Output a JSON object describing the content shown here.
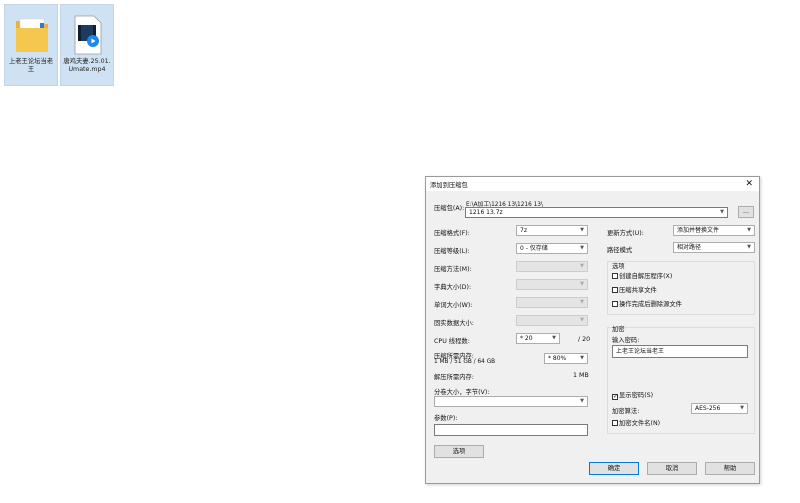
{
  "desktop": {
    "icons": [
      {
        "label": "上老王论坛当老王",
        "icon": "folder-icon"
      },
      {
        "label": "唐鸡夫妻.25.01.Umate.mp4",
        "icon": "video-file-icon"
      }
    ]
  },
  "dialog": {
    "title": "添加到压缩包",
    "close_glyph": "✕",
    "archive": {
      "label": "压缩包(A):",
      "path": "E:\\A加工\\1216 13\\1216 13\\",
      "value": "1216 13.7z",
      "browse_label": "..."
    },
    "left": {
      "format": {
        "label": "压缩格式(F):",
        "value": "7z"
      },
      "level": {
        "label": "压缩等级(L):",
        "value": "0 - 仅存储"
      },
      "method": {
        "label": "压缩方法(M):",
        "value": ""
      },
      "dict": {
        "label": "字典大小(D):",
        "value": ""
      },
      "word": {
        "label": "单词大小(W):",
        "value": ""
      },
      "solid": {
        "label": "固实数据大小:",
        "value": ""
      },
      "cpu": {
        "label": "CPU 线程数:",
        "value": "* 20",
        "max": "/ 20"
      },
      "mem_compress": {
        "label": "压缩所需内存:",
        "detail": "1 MB / 51 GB / 64 GB",
        "value": "* 80%"
      },
      "mem_decompress": {
        "label": "解压所需内存:",
        "value": "1 MB"
      },
      "split": {
        "label": "分卷大小，字节(V):",
        "value": ""
      },
      "params": {
        "label": "参数(P):",
        "value": ""
      },
      "options_button": "选项"
    },
    "right": {
      "update": {
        "label": "更新方式(U):",
        "value": "添加并替换文件"
      },
      "path_mode": {
        "label": "路径模式",
        "value": "相对路径"
      },
      "options_group": {
        "title": "选项",
        "sfx": {
          "label": "创建自解压程序(X)",
          "checked": false
        },
        "shared": {
          "label": "压缩共享文件",
          "checked": false
        },
        "delete": {
          "label": "操作完成后删除源文件",
          "checked": false
        }
      },
      "encryption": {
        "title": "加密",
        "password_label": "输入密码:",
        "password_value": "上老王论坛当老王",
        "show_password": {
          "label": "显示密码(S)",
          "checked": true
        },
        "method_label": "加密算法:",
        "method_value": "AES-256",
        "encrypt_names": {
          "label": "加密文件名(N)",
          "checked": false
        }
      }
    },
    "buttons": {
      "ok": "确定",
      "cancel": "取消",
      "help": "帮助"
    }
  }
}
